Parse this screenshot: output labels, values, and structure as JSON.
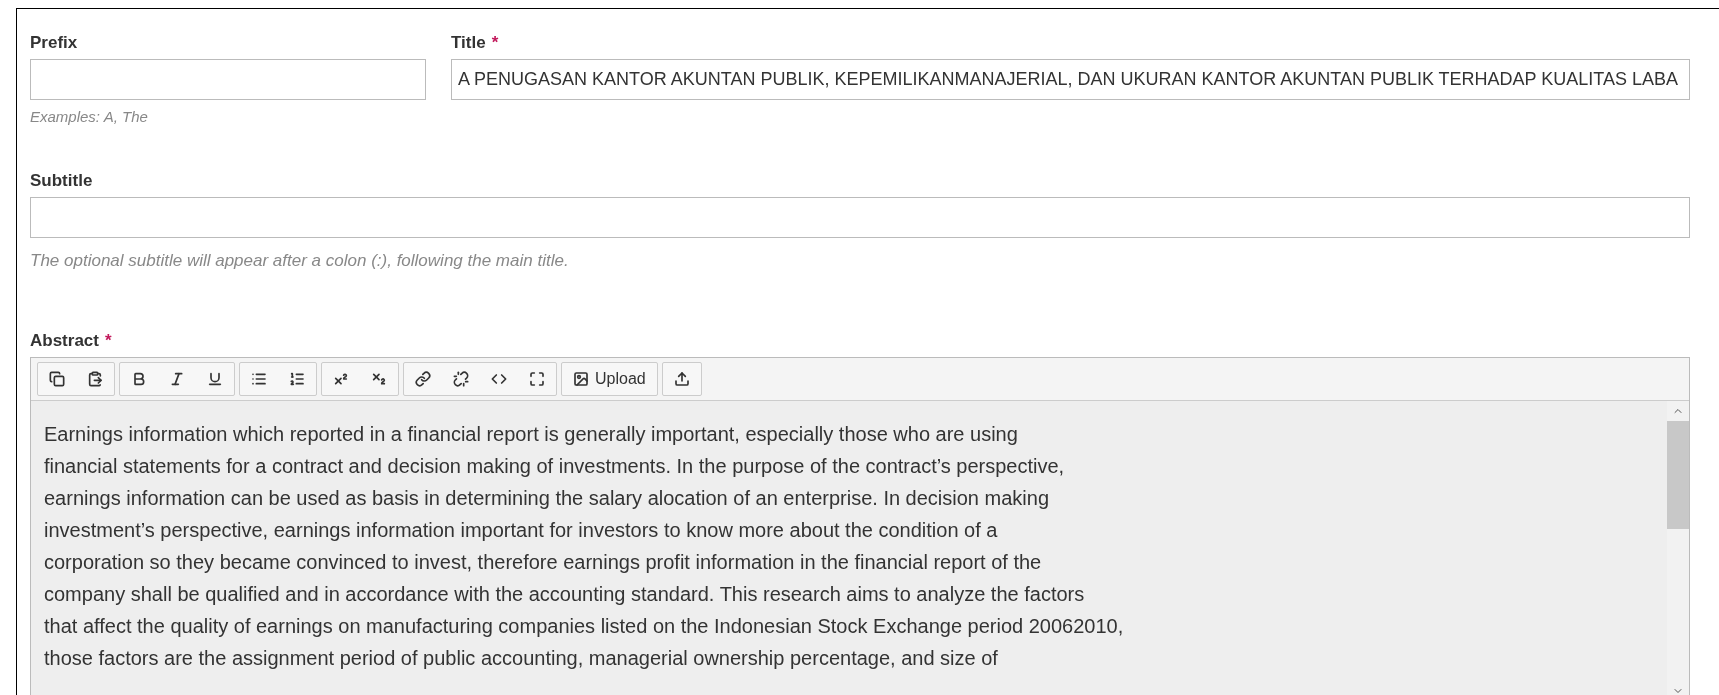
{
  "prefix": {
    "label": "Prefix",
    "help": "Examples: A, The"
  },
  "title": {
    "label": "Title",
    "required_mark": "*",
    "value": "A PENUGASAN KANTOR AKUNTAN PUBLIK, KEPEMILIKANMANAJERIAL, DAN UKURAN KANTOR AKUNTAN PUBLIK  TERHADAP KUALITAS LABA"
  },
  "subtitle": {
    "label": "Subtitle",
    "help": "The optional subtitle will appear after a colon (:), following the main title."
  },
  "abstract": {
    "label": "Abstract",
    "required_mark": "*",
    "toolbar_groups": [
      [
        {
          "kind": "copy"
        },
        {
          "kind": "paste"
        }
      ],
      [
        {
          "kind": "bold"
        },
        {
          "kind": "italic"
        },
        {
          "kind": "underline"
        }
      ],
      [
        {
          "kind": "bullets"
        },
        {
          "kind": "numbers"
        }
      ],
      [
        {
          "kind": "superscript"
        },
        {
          "kind": "subscript"
        }
      ],
      [
        {
          "kind": "link"
        },
        {
          "kind": "unlink"
        },
        {
          "kind": "code"
        },
        {
          "kind": "fullscreen"
        }
      ],
      [
        {
          "kind": "image",
          "label": "Upload"
        }
      ],
      [
        {
          "kind": "upload"
        }
      ]
    ],
    "lines": [
      "Earnings information which reported in a financial report is generally important, especially those who are using",
      "financial statements for a contract and decision making of investments. In the purpose of the contract’s perspective,",
      "earnings information can be used as basis in determining the salary alocation of an enterprise. In decision making",
      "investment’s perspective, earnings information important for investors to know more about the condition of a",
      "corporation so they became convinced to invest, therefore earnings profit information in the financial report of the",
      "company shall be qualified and in accordance with the accounting standard. This research aims to analyze the factors",
      "that affect the quality of earnings on manufacturing companies listed on the Indonesian Stock Exchange period 20062010,",
      "those factors are the assignment period of public accounting, managerial ownership percentage, and size of"
    ]
  }
}
